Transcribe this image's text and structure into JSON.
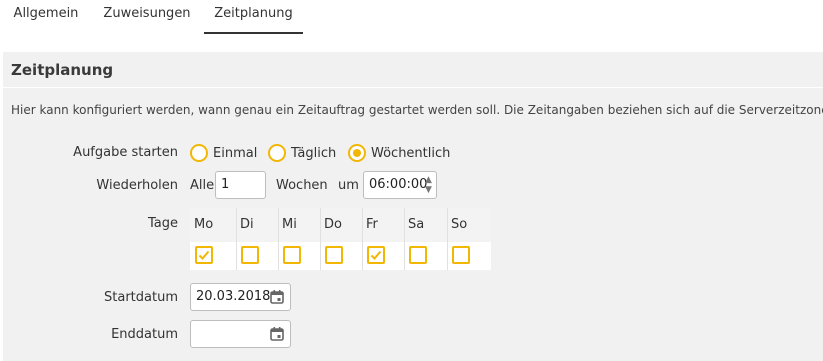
{
  "tabs": [
    {
      "label": "Allgemein",
      "active": false
    },
    {
      "label": "Zuweisungen",
      "active": false
    },
    {
      "label": "Zeitplanung",
      "active": true
    }
  ],
  "panel": {
    "title": "Zeitplanung",
    "description": "Hier kann konfiguriert werden, wann genau ein Zeitauftrag gestartet werden soll. Die Zeitangaben beziehen sich auf die Serverzeitzone."
  },
  "start": {
    "label": "Aufgabe starten",
    "options": [
      {
        "label": "Einmal",
        "selected": false
      },
      {
        "label": "Täglich",
        "selected": false
      },
      {
        "label": "Wöchentlich",
        "selected": true
      }
    ]
  },
  "repeat": {
    "label": "Wiederholen",
    "prefix": "Alle",
    "value": "1",
    "unit": "Wochen",
    "at_label": "um",
    "time": "06:00:00"
  },
  "days": {
    "label": "Tage",
    "items": [
      {
        "label": "Mo",
        "checked": true
      },
      {
        "label": "Di",
        "checked": false
      },
      {
        "label": "Mi",
        "checked": false
      },
      {
        "label": "Do",
        "checked": false
      },
      {
        "label": "Fr",
        "checked": true
      },
      {
        "label": "Sa",
        "checked": false
      },
      {
        "label": "So",
        "checked": false
      }
    ]
  },
  "startdate": {
    "label": "Startdatum",
    "value": "20.03.2018"
  },
  "enddate": {
    "label": "Enddatum",
    "value": ""
  },
  "colors": {
    "accent": "#f2b705",
    "panel_bg": "#f1f1f1"
  },
  "icons": {
    "calendar": "calendar-icon",
    "spinner": "spinner-arrows-icon",
    "check": "check-icon"
  }
}
